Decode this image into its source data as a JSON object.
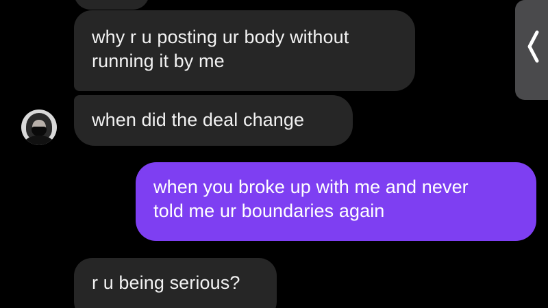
{
  "thread": {
    "messages": [
      {
        "sender": "other",
        "lines": [
          "why r u posting ur body without",
          "running it by me"
        ]
      },
      {
        "sender": "other",
        "lines": [
          "when did the deal change"
        ]
      },
      {
        "sender": "me",
        "lines": [
          "when you broke up with me and never",
          "told me ur boundaries again"
        ]
      },
      {
        "sender": "other",
        "lines": [
          "r u being serious?"
        ]
      }
    ]
  },
  "side_panel": {
    "icon": "chevron-left-icon"
  },
  "colors": {
    "background": "#000000",
    "incoming_bubble": "#262626",
    "outgoing_bubble": "#7e3ff2",
    "incoming_text": "#f2f2f2",
    "outgoing_text": "#ffffff",
    "side_handle": "#4a4a4c"
  }
}
